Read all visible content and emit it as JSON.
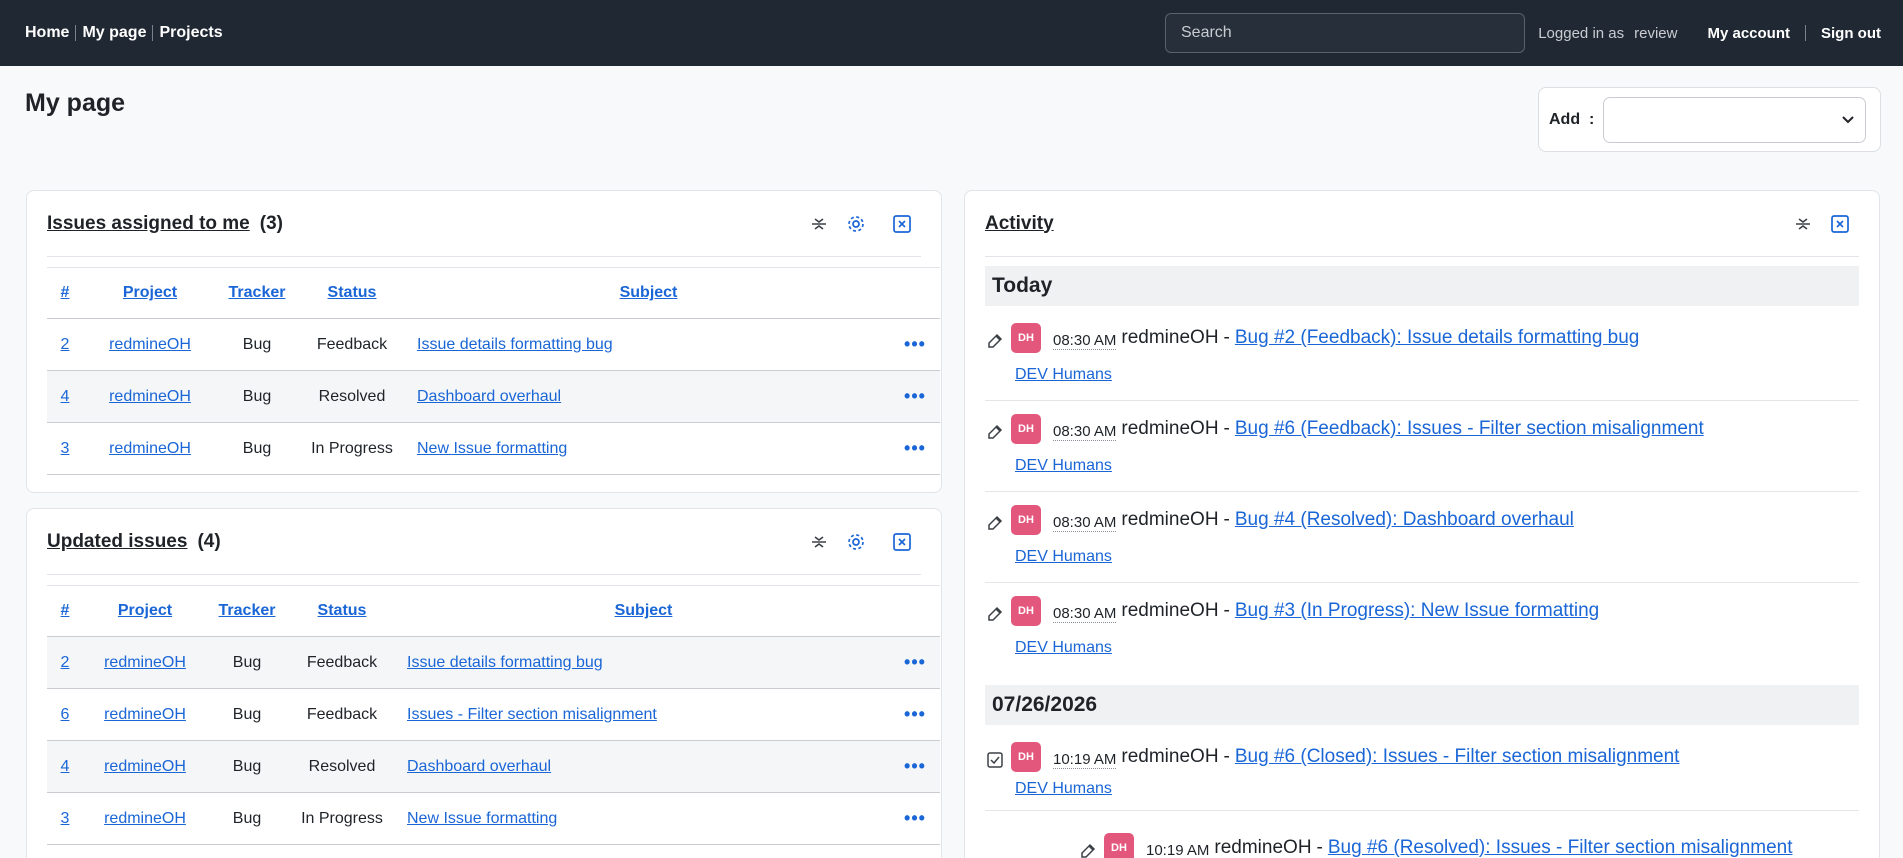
{
  "topnav": {
    "home": "Home",
    "mypage": "My page",
    "projects": "Projects"
  },
  "search": {
    "placeholder": "Search"
  },
  "user": {
    "logged_in_as": "Logged in as",
    "name": "review",
    "my_account": "My account",
    "sign_out": "Sign out"
  },
  "page": {
    "title": "My page"
  },
  "add": {
    "label": "Add",
    "colon": ":",
    "selected": ""
  },
  "assigned": {
    "title": "Issues assigned to me",
    "count": "(3)",
    "columns": [
      "#",
      "Project",
      "Tracker",
      "Status",
      "Subject"
    ],
    "rows": [
      {
        "id": "2",
        "project": "redmineOH",
        "tracker": "Bug",
        "status": "Feedback",
        "subject": "Issue details formatting bug"
      },
      {
        "id": "4",
        "project": "redmineOH",
        "tracker": "Bug",
        "status": "Resolved",
        "subject": "Dashboard overhaul"
      },
      {
        "id": "3",
        "project": "redmineOH",
        "tracker": "Bug",
        "status": "In Progress",
        "subject": "New Issue formatting"
      }
    ]
  },
  "updated": {
    "title": "Updated issues",
    "count": "(4)",
    "columns": [
      "#",
      "Project",
      "Tracker",
      "Status",
      "Subject"
    ],
    "rows": [
      {
        "id": "2",
        "project": "redmineOH",
        "tracker": "Bug",
        "status": "Feedback",
        "subject": "Issue details formatting bug"
      },
      {
        "id": "6",
        "project": "redmineOH",
        "tracker": "Bug",
        "status": "Feedback",
        "subject": "Issues - Filter section misalignment"
      },
      {
        "id": "4",
        "project": "redmineOH",
        "tracker": "Bug",
        "status": "Resolved",
        "subject": "Dashboard overhaul"
      },
      {
        "id": "3",
        "project": "redmineOH",
        "tracker": "Bug",
        "status": "In Progress",
        "subject": "New Issue formatting"
      }
    ]
  },
  "more_glyph": "•••",
  "activity": {
    "title": "Activity",
    "days": [
      {
        "label": "Today",
        "items": [
          {
            "icon": "edit-icon",
            "avatar": "DH",
            "time": "08:30 AM",
            "author": "redmineOH",
            "title": "Bug #2 (Feedback): Issue details formatting bug",
            "project": "DEV Humans"
          },
          {
            "icon": "edit-icon",
            "avatar": "DH",
            "time": "08:30 AM",
            "author": "redmineOH",
            "title": "Bug #6 (Feedback): Issues - Filter section misalignment",
            "project": "DEV Humans"
          },
          {
            "icon": "edit-icon",
            "avatar": "DH",
            "time": "08:30 AM",
            "author": "redmineOH",
            "title": "Bug #4 (Resolved): Dashboard overhaul",
            "project": "DEV Humans"
          },
          {
            "icon": "edit-icon",
            "avatar": "DH",
            "time": "08:30 AM",
            "author": "redmineOH",
            "title": "Bug #3 (In Progress): New Issue formatting",
            "project": "DEV Humans"
          }
        ]
      },
      {
        "label": "07/26/2026",
        "items": [
          {
            "icon": "closed-checkbox-icon",
            "avatar": "DH",
            "time": "10:19 AM",
            "author": "redmineOH",
            "title": "Bug #6 (Closed): Issues - Filter section misalignment",
            "project": "DEV Humans"
          },
          {
            "icon": "edit-icon",
            "avatar": "DH",
            "time": "10:19 AM",
            "author": "redmineOH",
            "title": "Bug #6 (Resolved): Issues - Filter section misalignment",
            "project": ""
          }
        ]
      }
    ]
  },
  "colors": {
    "topbar": "#202833",
    "link": "#1a66d6",
    "avatar": "#e4577d"
  }
}
